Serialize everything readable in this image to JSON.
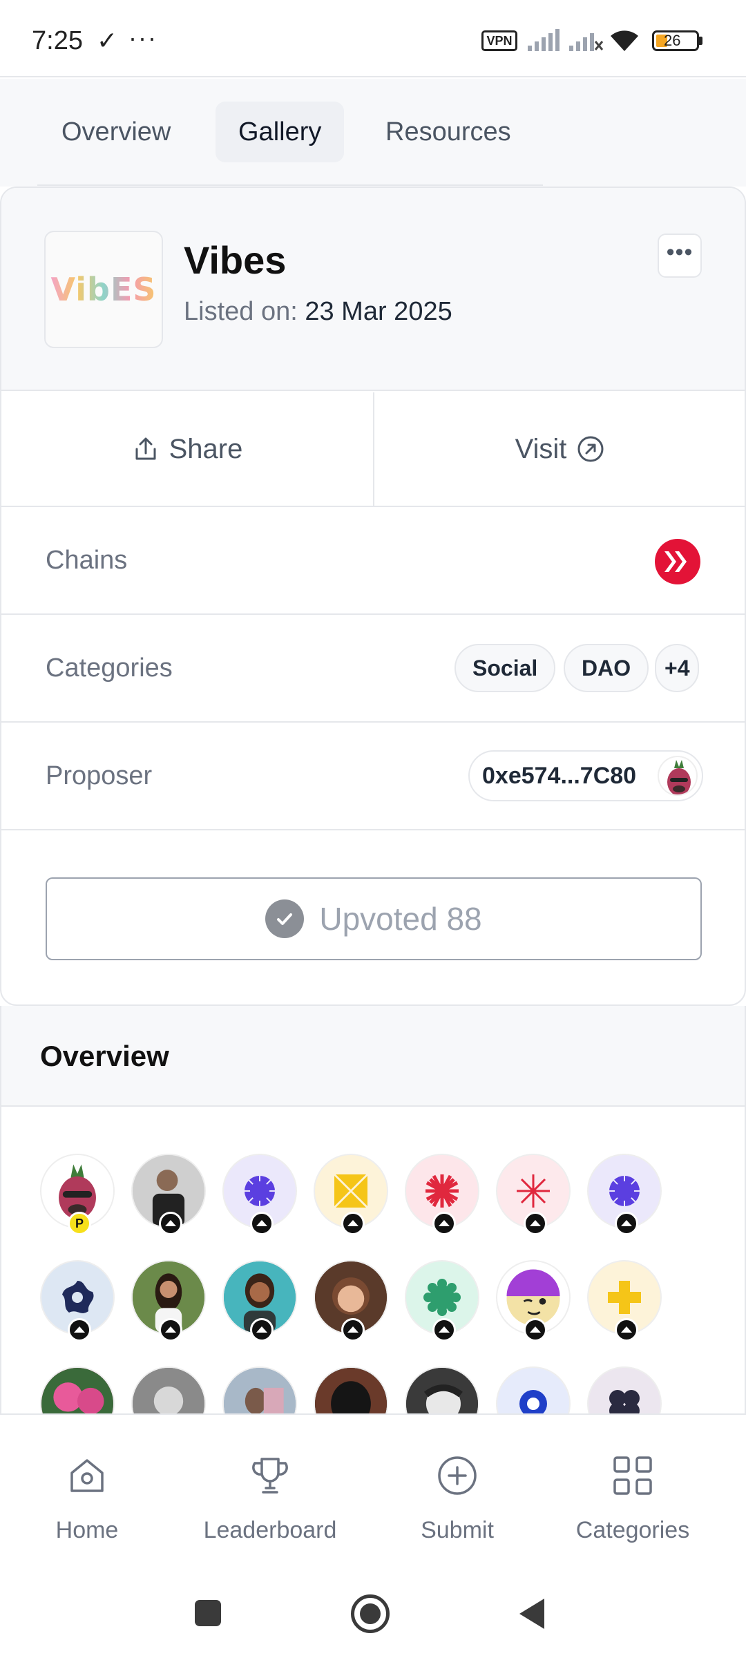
{
  "status_bar": {
    "time": "7:25",
    "vpn": "VPN",
    "battery": "26"
  },
  "tabs": [
    {
      "label": "Overview",
      "active": false
    },
    {
      "label": "Gallery",
      "active": true
    },
    {
      "label": "Resources",
      "active": false
    }
  ],
  "project": {
    "logo_text": "VibES",
    "title": "Vibes",
    "listed_label": "Listed on:",
    "listed_date": "23 Mar 2025"
  },
  "actions": {
    "share": "Share",
    "visit": "Visit"
  },
  "chains": {
    "label": "Chains",
    "icon": "hive-chain-icon",
    "color": "#e31337"
  },
  "categories": {
    "label": "Categories",
    "items": [
      "Social",
      "DAO",
      "+4"
    ]
  },
  "proposer": {
    "label": "Proposer",
    "address": "0xe574...7C80"
  },
  "upvote": {
    "label": "Upvoted 88"
  },
  "overview": {
    "title": "Overview",
    "voter_badge_owner": "P"
  },
  "bottom_nav": [
    {
      "label": "Home",
      "icon": "home-icon"
    },
    {
      "label": "Leaderboard",
      "icon": "trophy-icon"
    },
    {
      "label": "Submit",
      "icon": "plus-circle-icon"
    },
    {
      "label": "Categories",
      "icon": "grid-icon"
    }
  ],
  "colors": {
    "accent_chain": "#e31337",
    "muted_text": "#6b7280",
    "border": "#e5e7eb"
  }
}
